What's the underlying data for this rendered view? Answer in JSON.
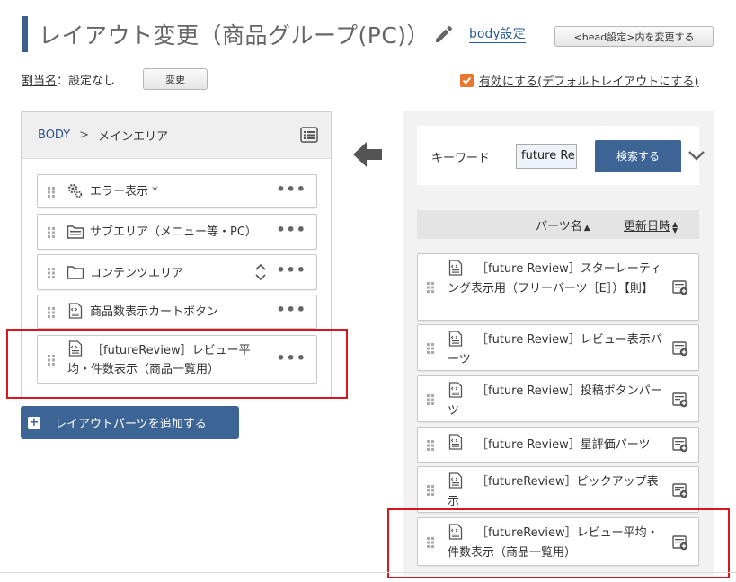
{
  "header": {
    "title": "レイアウト変更（商品グループ(PC)）",
    "body_settings_link": "body設定",
    "head_settings_button": "<head設定>内を変更する"
  },
  "assignment": {
    "label": "割当名",
    "value": "：設定なし",
    "change_button": "変更",
    "enable_checked": true,
    "enable_label": "有効にする(デフォルトレイアウトにする)"
  },
  "left_panel": {
    "breadcrumb_root": "BODY",
    "breadcrumb_sep": ">",
    "breadcrumb_current": "メインエリア",
    "parts": [
      {
        "label": "エラー表示 *",
        "icon": "gears-icon"
      },
      {
        "label": "サブエリア（メニュー等・PC）",
        "icon": "folder-icon"
      },
      {
        "label": "コンテンツエリア",
        "icon": "folder-icon"
      },
      {
        "label": "商品数表示カートボタン",
        "icon": "code-file-icon"
      },
      {
        "label_line1": "［futureReview］レビュー平",
        "label_line2": "均・件数表示（商品一覧用）",
        "icon": "code-file-icon"
      }
    ],
    "add_button": "レイアウトパーツを追加する"
  },
  "right_panel": {
    "keyword_label": "キーワード",
    "keyword_value": "future Re",
    "search_button": "検索する",
    "sort_parts_name": "パーツ名",
    "sort_updated": "更新日時",
    "parts": [
      {
        "label": "［future Review］スターレーティング表示用（フリーパーツ［E］）【則】"
      },
      {
        "label": "［future Review］レビュー表示パーツ"
      },
      {
        "label": "［future Review］投稿ボタンパーツ"
      },
      {
        "label": "［future Review］星評価パーツ"
      },
      {
        "label": "［futureReview］ピックアップ表示"
      },
      {
        "label": "［futureReview］レビュー平均・件数表示（商品一覧用）"
      }
    ]
  },
  "colors": {
    "accent": "#3c6596",
    "highlight": "#d9161d",
    "checkbox": "#e8762c"
  }
}
